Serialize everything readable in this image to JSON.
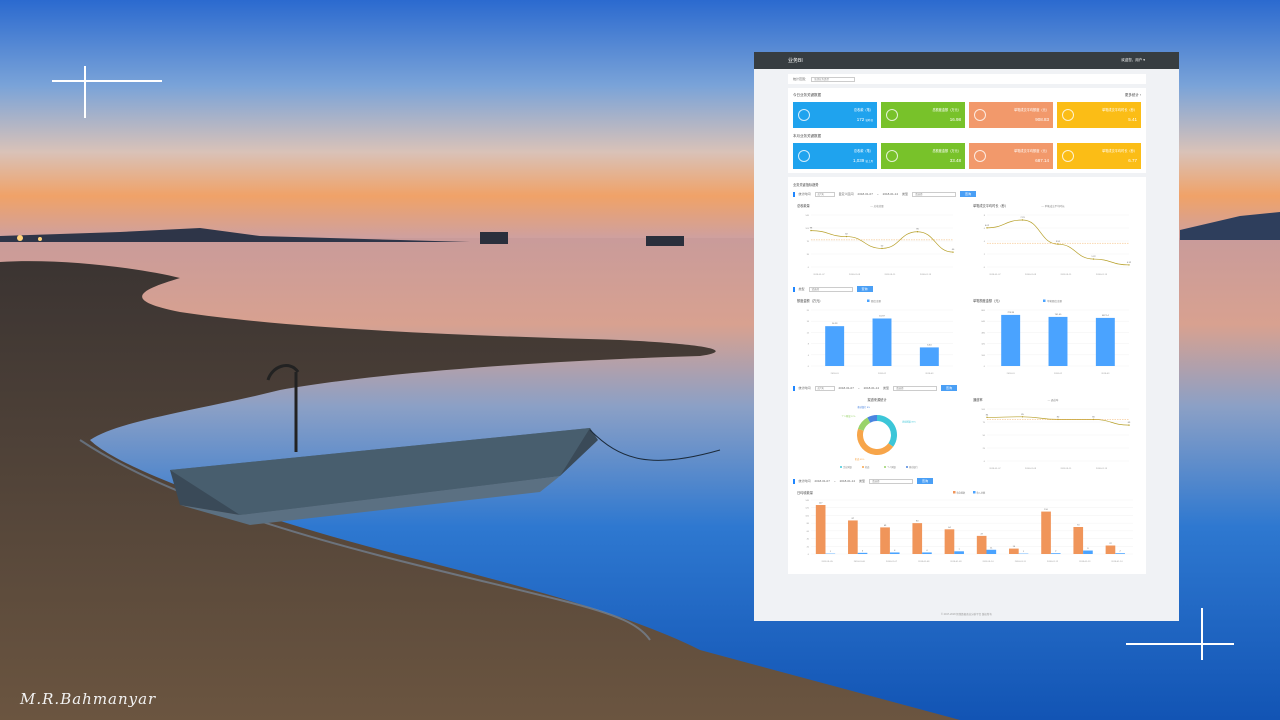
{
  "photo": {
    "signature": "M.R.Bahmanyar",
    "colors": {
      "sky_top": "#2e6fcf",
      "horizon": "#e8925a",
      "water": "#3a7fd0",
      "shore": "#2a2520"
    }
  },
  "dashboard": {
    "app_title": "业务BI",
    "user_menu": "欢迎您，用户 ▾",
    "filter": {
      "label": "统计范围：",
      "value": "全部业务类型"
    },
    "today": {
      "title": "今日业务关键数据",
      "link": "更多统计 ›",
      "kpis": [
        {
          "label": "总收款（笔）",
          "value": "172",
          "sub": "较昨日",
          "icon": "layers-icon",
          "color": "#1fa3ee"
        },
        {
          "label": "总额度金额（万元）",
          "value": "16.98",
          "icon": "coins-icon",
          "color": "#78c22a"
        },
        {
          "label": "单笔成交平均额度（元）",
          "value": "908.83",
          "icon": "yuan-icon",
          "color": "#f2996b"
        },
        {
          "label": "单笔成交平均时长（秒）",
          "value": "5.41",
          "icon": "clock-icon",
          "color": "#fbbd16"
        }
      ]
    },
    "month": {
      "title": "本月业务关键数据",
      "kpis": [
        {
          "label": "总收款（笔）",
          "value": "1,039",
          "sub": "较上月",
          "icon": "layers-icon",
          "color": "#1fa3ee"
        },
        {
          "label": "总额度金额（万元）",
          "value": "33.48",
          "icon": "coins-icon",
          "color": "#78c22a"
        },
        {
          "label": "单笔成交平均额度（元）",
          "value": "687.14",
          "icon": "yuan-icon",
          "color": "#f2996b"
        },
        {
          "label": "单笔成交平均时长（秒）",
          "value": "6.77",
          "icon": "clock-icon",
          "color": "#fbbd16"
        }
      ]
    },
    "trend": {
      "title": "业务关键指标趋势",
      "controls": {
        "range_label": "统计时间",
        "range_value": "近7天",
        "date_label": "自定义区间",
        "from": "2018-01-07",
        "sep": "~",
        "to": "2018-01-14",
        "type_label": "类型",
        "type_placeholder": "请选择",
        "query": "查询"
      },
      "controls2": {
        "type_label": "类型",
        "type_placeholder": "请选择",
        "query": "查询"
      },
      "controls3": {
        "range_label": "统计时间",
        "range_value": "近7天",
        "from": "2018-01-07",
        "sep": "~",
        "to": "2018-01-14",
        "type_label": "类型",
        "type_placeholder": "请选择",
        "query": "查询"
      },
      "controls4": {
        "date_label": "统计时间",
        "from": "2018-01-07",
        "sep": "~",
        "to": "2018-01-14",
        "type_label": "类型",
        "type_placeholder": "请选择",
        "query": "查询"
      }
    },
    "footer": "© 2017-2018 智慧数据商业分析平台 版权所有"
  },
  "chart_data": [
    {
      "type": "line",
      "title": "总收款量",
      "legend": [
        "总收款量"
      ],
      "x": [
        "2018-01-07",
        "2018-01-09",
        "2018-01-11",
        "2018-01-13"
      ],
      "series": [
        {
          "name": "总收款量",
          "values": [
            98,
            82,
            50,
            95,
            40
          ]
        }
      ],
      "ylim": [
        0,
        140
      ],
      "yticks": [
        0,
        20,
        40,
        60,
        80,
        100,
        120,
        140
      ]
    },
    {
      "type": "line",
      "title": "单笔成交平均时长（秒）",
      "legend": [
        "单笔成交平均时长"
      ],
      "x": [
        "2018-01-07",
        "2018-01-09",
        "2018-01-11",
        "2018-01-13"
      ],
      "series": [
        {
          "name": "单笔成交平均时长",
          "values": [
            6.02,
            7.23,
            3.51,
            1.22,
            0.32
          ]
        }
      ],
      "ylim": [
        0,
        8
      ]
    },
    {
      "type": "bar",
      "title": "额度金额（万元）",
      "legend": [
        "额度金额"
      ],
      "categories": [
        "2018-01",
        "2018-02",
        "2018-03"
      ],
      "values": [
        14.23,
        16.97,
        6.64
      ],
      "ylim": [
        0,
        20
      ]
    },
    {
      "type": "bar",
      "title": "单笔额度金额（元）",
      "legend": [
        "单笔额度金额"
      ],
      "categories": [
        "2018-01",
        "2018-02",
        "2018-03"
      ],
      "values": [
        729.99,
        701.45,
        687.14
      ],
      "ylim": [
        0,
        800
      ]
    },
    {
      "type": "pie",
      "title": "渠道来源统计",
      "labels": [
        "企业网银",
        "柜面",
        "个人网银",
        "移动银行"
      ],
      "values": [
        35.0,
        45.0,
        12.0,
        8.0
      ]
    },
    {
      "type": "line",
      "title": "通道率",
      "legend": [
        "通道率"
      ],
      "x": [
        "2018-01-07",
        "2018-01-09",
        "2018-01-11",
        "2018-01-13"
      ],
      "series": [
        {
          "name": "通道率",
          "values": [
            84,
            85,
            80,
            80,
            69
          ]
        }
      ],
      "ylim": [
        0,
        100
      ]
    },
    {
      "type": "bar",
      "title": "日均收款量",
      "legend": [
        "收款笔数",
        "收入金额"
      ],
      "categories": [
        "2018-01-05",
        "2018-01-06",
        "2018-01-07",
        "2018-01-08",
        "2018-01-09",
        "2018-01-10",
        "2018-01-11",
        "2018-01-12",
        "2018-01-13",
        "2018-01-14"
      ],
      "series": [
        {
          "name": "收款笔数",
          "values": [
            127,
            87,
            69,
            80,
            64,
            47,
            14,
            110,
            70,
            22
          ]
        },
        {
          "name": "收入金额",
          "values": [
            1,
            3,
            4,
            4,
            7,
            11,
            1,
            2,
            9,
            2
          ]
        }
      ],
      "ylim": [
        0,
        140
      ]
    }
  ]
}
